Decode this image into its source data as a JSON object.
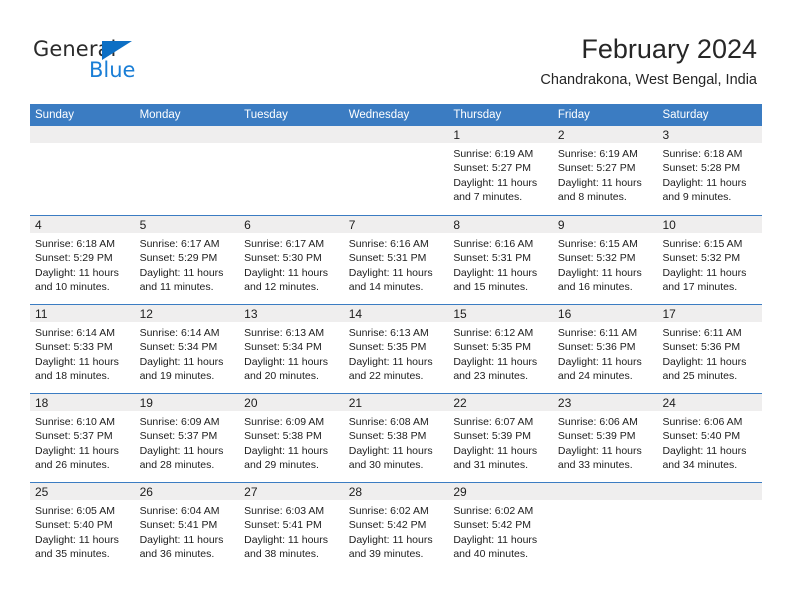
{
  "brand": {
    "name_top": "General",
    "name_bottom": "Blue",
    "triangle_icon": "blue-triangle-icon",
    "color_text": "#2b2b2b",
    "color_blue": "#1a7ed6"
  },
  "header": {
    "title": "February 2024",
    "subtitle": "Chandrakona, West Bengal, India"
  },
  "colors": {
    "header_blue": "#3b7cc2",
    "day_band_gray": "#efeeee",
    "text": "#1d1d1d"
  },
  "calendar": {
    "weekdays": [
      "Sunday",
      "Monday",
      "Tuesday",
      "Wednesday",
      "Thursday",
      "Friday",
      "Saturday"
    ],
    "weeks": [
      [
        {
          "day": "",
          "empty": true,
          "lines": []
        },
        {
          "day": "",
          "empty": true,
          "lines": []
        },
        {
          "day": "",
          "empty": true,
          "lines": []
        },
        {
          "day": "",
          "empty": true,
          "lines": []
        },
        {
          "day": "1",
          "empty": false,
          "lines": [
            "Sunrise: 6:19 AM",
            "Sunset: 5:27 PM",
            "Daylight: 11 hours",
            "and 7 minutes."
          ]
        },
        {
          "day": "2",
          "empty": false,
          "lines": [
            "Sunrise: 6:19 AM",
            "Sunset: 5:27 PM",
            "Daylight: 11 hours",
            "and 8 minutes."
          ]
        },
        {
          "day": "3",
          "empty": false,
          "lines": [
            "Sunrise: 6:18 AM",
            "Sunset: 5:28 PM",
            "Daylight: 11 hours",
            "and 9 minutes."
          ]
        }
      ],
      [
        {
          "day": "4",
          "empty": false,
          "lines": [
            "Sunrise: 6:18 AM",
            "Sunset: 5:29 PM",
            "Daylight: 11 hours",
            "and 10 minutes."
          ]
        },
        {
          "day": "5",
          "empty": false,
          "lines": [
            "Sunrise: 6:17 AM",
            "Sunset: 5:29 PM",
            "Daylight: 11 hours",
            "and 11 minutes."
          ]
        },
        {
          "day": "6",
          "empty": false,
          "lines": [
            "Sunrise: 6:17 AM",
            "Sunset: 5:30 PM",
            "Daylight: 11 hours",
            "and 12 minutes."
          ]
        },
        {
          "day": "7",
          "empty": false,
          "lines": [
            "Sunrise: 6:16 AM",
            "Sunset: 5:31 PM",
            "Daylight: 11 hours",
            "and 14 minutes."
          ]
        },
        {
          "day": "8",
          "empty": false,
          "lines": [
            "Sunrise: 6:16 AM",
            "Sunset: 5:31 PM",
            "Daylight: 11 hours",
            "and 15 minutes."
          ]
        },
        {
          "day": "9",
          "empty": false,
          "lines": [
            "Sunrise: 6:15 AM",
            "Sunset: 5:32 PM",
            "Daylight: 11 hours",
            "and 16 minutes."
          ]
        },
        {
          "day": "10",
          "empty": false,
          "lines": [
            "Sunrise: 6:15 AM",
            "Sunset: 5:32 PM",
            "Daylight: 11 hours",
            "and 17 minutes."
          ]
        }
      ],
      [
        {
          "day": "11",
          "empty": false,
          "lines": [
            "Sunrise: 6:14 AM",
            "Sunset: 5:33 PM",
            "Daylight: 11 hours",
            "and 18 minutes."
          ]
        },
        {
          "day": "12",
          "empty": false,
          "lines": [
            "Sunrise: 6:14 AM",
            "Sunset: 5:34 PM",
            "Daylight: 11 hours",
            "and 19 minutes."
          ]
        },
        {
          "day": "13",
          "empty": false,
          "lines": [
            "Sunrise: 6:13 AM",
            "Sunset: 5:34 PM",
            "Daylight: 11 hours",
            "and 20 minutes."
          ]
        },
        {
          "day": "14",
          "empty": false,
          "lines": [
            "Sunrise: 6:13 AM",
            "Sunset: 5:35 PM",
            "Daylight: 11 hours",
            "and 22 minutes."
          ]
        },
        {
          "day": "15",
          "empty": false,
          "lines": [
            "Sunrise: 6:12 AM",
            "Sunset: 5:35 PM",
            "Daylight: 11 hours",
            "and 23 minutes."
          ]
        },
        {
          "day": "16",
          "empty": false,
          "lines": [
            "Sunrise: 6:11 AM",
            "Sunset: 5:36 PM",
            "Daylight: 11 hours",
            "and 24 minutes."
          ]
        },
        {
          "day": "17",
          "empty": false,
          "lines": [
            "Sunrise: 6:11 AM",
            "Sunset: 5:36 PM",
            "Daylight: 11 hours",
            "and 25 minutes."
          ]
        }
      ],
      [
        {
          "day": "18",
          "empty": false,
          "lines": [
            "Sunrise: 6:10 AM",
            "Sunset: 5:37 PM",
            "Daylight: 11 hours",
            "and 26 minutes."
          ]
        },
        {
          "day": "19",
          "empty": false,
          "lines": [
            "Sunrise: 6:09 AM",
            "Sunset: 5:37 PM",
            "Daylight: 11 hours",
            "and 28 minutes."
          ]
        },
        {
          "day": "20",
          "empty": false,
          "lines": [
            "Sunrise: 6:09 AM",
            "Sunset: 5:38 PM",
            "Daylight: 11 hours",
            "and 29 minutes."
          ]
        },
        {
          "day": "21",
          "empty": false,
          "lines": [
            "Sunrise: 6:08 AM",
            "Sunset: 5:38 PM",
            "Daylight: 11 hours",
            "and 30 minutes."
          ]
        },
        {
          "day": "22",
          "empty": false,
          "lines": [
            "Sunrise: 6:07 AM",
            "Sunset: 5:39 PM",
            "Daylight: 11 hours",
            "and 31 minutes."
          ]
        },
        {
          "day": "23",
          "empty": false,
          "lines": [
            "Sunrise: 6:06 AM",
            "Sunset: 5:39 PM",
            "Daylight: 11 hours",
            "and 33 minutes."
          ]
        },
        {
          "day": "24",
          "empty": false,
          "lines": [
            "Sunrise: 6:06 AM",
            "Sunset: 5:40 PM",
            "Daylight: 11 hours",
            "and 34 minutes."
          ]
        }
      ],
      [
        {
          "day": "25",
          "empty": false,
          "lines": [
            "Sunrise: 6:05 AM",
            "Sunset: 5:40 PM",
            "Daylight: 11 hours",
            "and 35 minutes."
          ]
        },
        {
          "day": "26",
          "empty": false,
          "lines": [
            "Sunrise: 6:04 AM",
            "Sunset: 5:41 PM",
            "Daylight: 11 hours",
            "and 36 minutes."
          ]
        },
        {
          "day": "27",
          "empty": false,
          "lines": [
            "Sunrise: 6:03 AM",
            "Sunset: 5:41 PM",
            "Daylight: 11 hours",
            "and 38 minutes."
          ]
        },
        {
          "day": "28",
          "empty": false,
          "lines": [
            "Sunrise: 6:02 AM",
            "Sunset: 5:42 PM",
            "Daylight: 11 hours",
            "and 39 minutes."
          ]
        },
        {
          "day": "29",
          "empty": false,
          "lines": [
            "Sunrise: 6:02 AM",
            "Sunset: 5:42 PM",
            "Daylight: 11 hours",
            "and 40 minutes."
          ]
        },
        {
          "day": "",
          "empty": true,
          "lines": []
        },
        {
          "day": "",
          "empty": true,
          "lines": []
        }
      ]
    ]
  }
}
